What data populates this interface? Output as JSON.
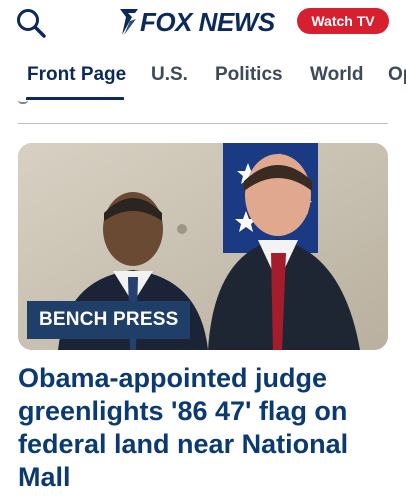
{
  "header": {
    "search_icon": "search-icon",
    "logo_text": "FOX NEWS",
    "watch_label": "Watch TV",
    "brand_color": "#0b2a5b",
    "watch_color": "#d7202f"
  },
  "nav": {
    "tabs": [
      {
        "label": "Front Page",
        "active": true
      },
      {
        "label": "U.S.",
        "active": false
      },
      {
        "label": "Politics",
        "active": false
      },
      {
        "label": "World",
        "active": false
      },
      {
        "label": "Op",
        "active": false
      }
    ]
  },
  "article": {
    "kicker": "BENCH PRESS",
    "headline": "Obama-appointed judge greenlights '86 47' flag on federal land near National Mall"
  }
}
